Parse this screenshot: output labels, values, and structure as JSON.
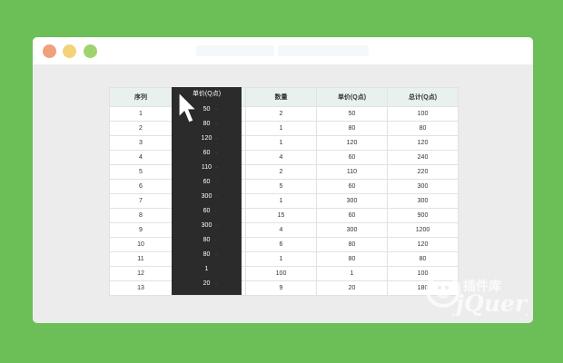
{
  "columns": {
    "seq": "序列",
    "price_dragging": "单价(Q点)",
    "qty": "数量",
    "price": "单价(Q点)",
    "total": "总计(Q点)"
  },
  "rows": [
    {
      "seq": "1",
      "drag": "50",
      "qty": "2",
      "price": "50",
      "total": "100"
    },
    {
      "seq": "2",
      "drag": "80",
      "qty": "1",
      "price": "80",
      "total": "80"
    },
    {
      "seq": "3",
      "drag": "120",
      "qty": "1",
      "price": "120",
      "total": "120"
    },
    {
      "seq": "4",
      "drag": "60",
      "qty": "4",
      "price": "60",
      "total": "240"
    },
    {
      "seq": "5",
      "drag": "110",
      "qty": "2",
      "price": "110",
      "total": "220"
    },
    {
      "seq": "6",
      "drag": "60",
      "qty": "5",
      "price": "60",
      "total": "300"
    },
    {
      "seq": "7",
      "drag": "300",
      "qty": "1",
      "price": "300",
      "total": "300"
    },
    {
      "seq": "8",
      "drag": "60",
      "qty": "15",
      "price": "60",
      "total": "900"
    },
    {
      "seq": "9",
      "drag": "300",
      "qty": "4",
      "price": "300",
      "total": "1200"
    },
    {
      "seq": "10",
      "drag": "80",
      "qty": "6",
      "price": "80",
      "total": "120"
    },
    {
      "seq": "11",
      "drag": "80",
      "qty": "1",
      "price": "80",
      "total": "80"
    },
    {
      "seq": "12",
      "drag": "1",
      "qty": "100",
      "price": "1",
      "total": "100"
    },
    {
      "seq": "13",
      "drag": "20",
      "qty": "9",
      "price": "20",
      "total": "180"
    }
  ],
  "colors": {
    "background": "#6cbf57",
    "window": "#ececec",
    "dragged_column": "#2b2b2b",
    "header_row": "#e8f1ee"
  },
  "icons": {
    "cursor": "mouse-pointer-icon",
    "watermark": "jquery-watermark-logo"
  },
  "watermark": {
    "text": "jQuery",
    "cn_text": "插件库"
  }
}
